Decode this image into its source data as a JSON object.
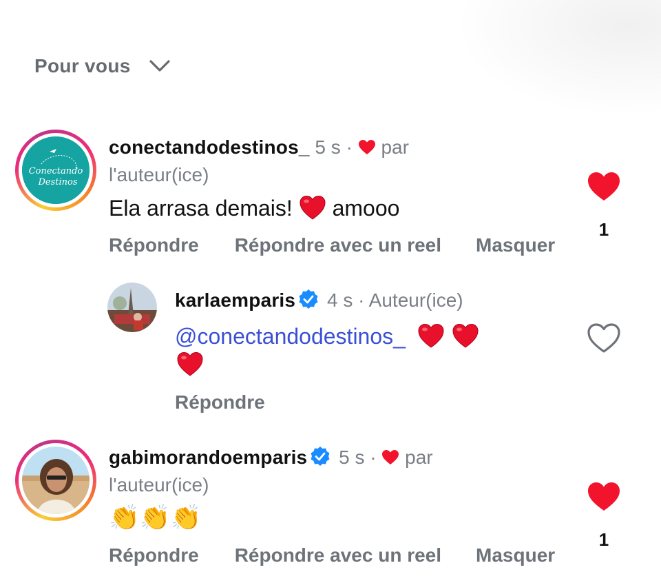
{
  "header": {
    "sort_label": "Pour vous",
    "sort_icon": "chevron-down-icon"
  },
  "colors": {
    "heart": "#f2142c",
    "link": "#3b4fd6",
    "verified": "#1a8cff",
    "muted": "#7a7f86"
  },
  "comments": [
    {
      "username": "conectandodestinos_",
      "time": "5 s",
      "sep": "·",
      "liked_by_author_suffix": "par",
      "liked_by_author_line2": "l'auteur(ice)",
      "text": "Ela arrasa demais! ",
      "text_emoji": "❤️",
      "text_after": " amooo",
      "avatar_logo_line1": "Conectando",
      "avatar_logo_line2": "Destinos",
      "actions": [
        "Répondre",
        "Répondre avec un reel",
        "Masquer"
      ],
      "like_count": "1",
      "liked": true
    },
    {
      "username": "karlaemparis",
      "verified": true,
      "time": "4 s",
      "sep": "·",
      "role": "Auteur(ice)",
      "mention": "@conectandodestinos_",
      "hearts": "❤️❤️❤️",
      "actions": [
        "Répondre"
      ],
      "liked": false
    },
    {
      "username": "gabimorandoemparis",
      "verified": true,
      "time": "5 s",
      "sep": "·",
      "liked_by_author_suffix": "par",
      "liked_by_author_line2": "l'auteur(ice)",
      "text": "👏👏👏",
      "actions": [
        "Répondre",
        "Répondre avec un reel",
        "Masquer"
      ],
      "like_count": "1",
      "liked": true
    }
  ]
}
